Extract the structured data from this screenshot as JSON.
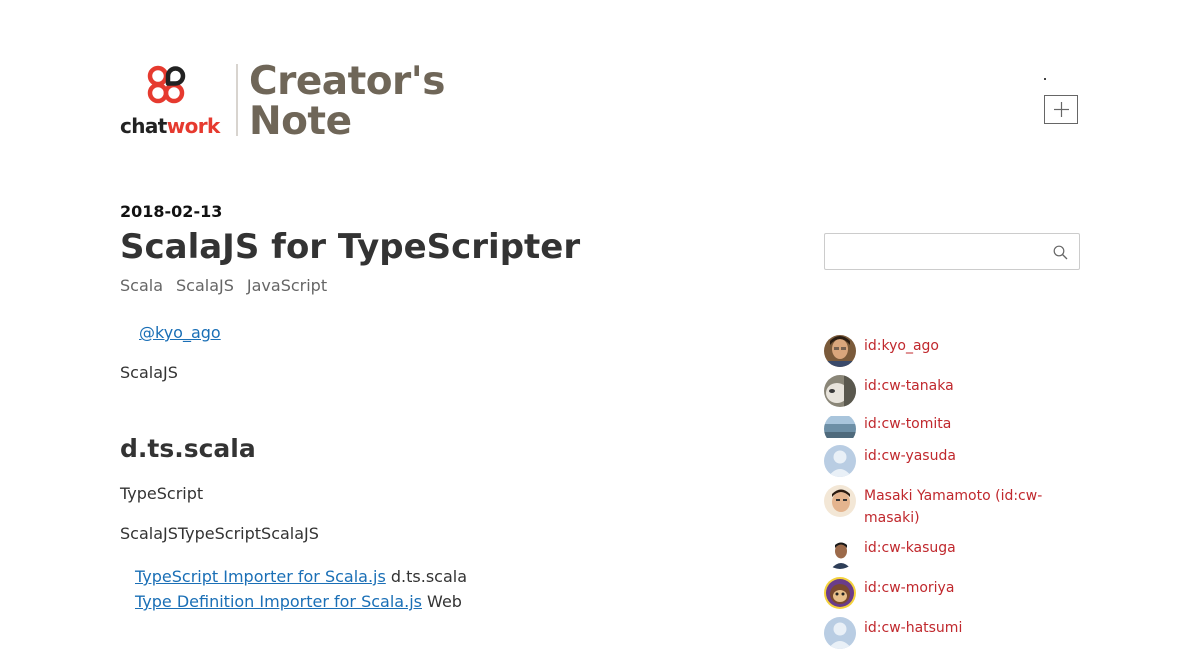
{
  "brand": {
    "logo_text_part1": "chat",
    "logo_text_part2": "work",
    "title_line1": "Creator's",
    "title_line2": "Note"
  },
  "post": {
    "date": "2018-02-13",
    "title": "ScalaJS for TypeScripter",
    "tags": [
      "Scala",
      "ScalaJS",
      "JavaScript"
    ],
    "author": "@kyo_ago",
    "intro": "ScalaJS",
    "section_heading": "d.ts.scala",
    "para1": "TypeScript",
    "para2": "ScalaJSTypeScriptScalaJS",
    "links": [
      {
        "link_text": "TypeScript Importer for Scala.js",
        "after_text": " d.ts.scala"
      },
      {
        "link_text": "Type Definition Importer for Scala.js",
        "after_text": " Web"
      }
    ]
  },
  "search": {
    "placeholder": ""
  },
  "members": [
    {
      "name": "id:kyo_ago",
      "avatar": "photo-man"
    },
    {
      "name": "id:cw-tanaka",
      "avatar": "photo-cat"
    },
    {
      "name": "id:cw-tomita",
      "avatar": "photo-lake"
    },
    {
      "name": "id:cw-yasuda",
      "avatar": "default-silhouette"
    },
    {
      "name": "Masaki Yamamoto (id:cw-masaki)",
      "avatar": "photo-man"
    },
    {
      "name": "id:cw-kasuga",
      "avatar": "photo-man"
    },
    {
      "name": "id:cw-moriya",
      "avatar": "illustration-monkey"
    },
    {
      "name": "id:cw-hatsumi",
      "avatar": "default-silhouette"
    }
  ],
  "colors": {
    "accent_red": "#c0282d",
    "link_blue": "#1a6fb6",
    "brand_brown": "#6f6658",
    "chatwork_red": "#e63a2f"
  }
}
